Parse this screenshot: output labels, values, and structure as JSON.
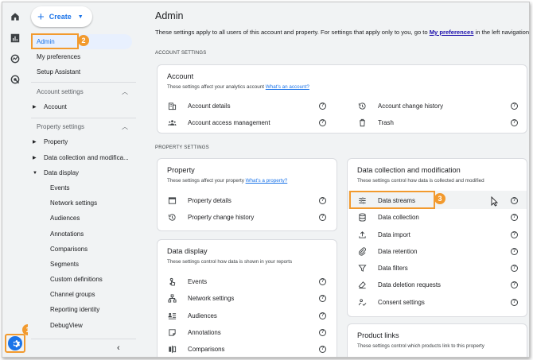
{
  "rail": {
    "icons": [
      "home-icon",
      "reports-icon",
      "explore-icon",
      "advertising-icon"
    ],
    "settings_icon": "gear-icon",
    "callout_1": "1"
  },
  "sidebar": {
    "create_label": "Create",
    "top_items": [
      "Admin",
      "My preferences",
      "Setup Assistant"
    ],
    "callout_2": "2",
    "account_settings_label": "Account settings",
    "account_item": "Account",
    "property_settings_label": "Property settings",
    "property_item": "Property",
    "data_collection_item": "Data collection and modifica...",
    "data_display_item": "Data display",
    "data_display_children": [
      "Events",
      "Network settings",
      "Audiences",
      "Annotations",
      "Comparisons",
      "Segments",
      "Custom definitions",
      "Channel groups",
      "Reporting identity",
      "DebugView"
    ],
    "collapse_icon": "chevron-left-icon"
  },
  "main": {
    "title": "Admin",
    "description": "These settings apply to all users of this account and property. For settings that apply only to you, go to ",
    "description_link": "My preferences",
    "description_end": " in the left navigation.",
    "account_settings_header": "ACCOUNT SETTINGS",
    "property_settings_header": "PROPERTY SETTINGS",
    "account_card": {
      "title": "Account",
      "desc": "These settings affect your analytics account ",
      "desc_link": "What's an account?",
      "rows": [
        "Account details",
        "Account access management",
        "Account change history",
        "Trash"
      ]
    },
    "property_card": {
      "title": "Property",
      "desc": "These settings affect your property ",
      "desc_link": "What's a property?",
      "rows": [
        "Property details",
        "Property change history"
      ]
    },
    "data_display_card": {
      "title": "Data display",
      "desc": "These settings control how data is shown in your reports",
      "rows": [
        "Events",
        "Network settings",
        "Audiences",
        "Annotations",
        "Comparisons"
      ]
    },
    "data_collection_card": {
      "title": "Data collection and modification",
      "desc": "These settings control how data is collected and modified",
      "rows": [
        "Data streams",
        "Data collection",
        "Data import",
        "Data retention",
        "Data filters",
        "Data deletion requests",
        "Consent settings"
      ],
      "callout_3": "3"
    },
    "product_links_card": {
      "title": "Product links",
      "desc": "These settings control which products link to this property"
    },
    "help_glyph": "?"
  },
  "colors": {
    "accent": "#1a73e8",
    "callout": "#f29a2e",
    "selected": "#e8f0fe"
  }
}
